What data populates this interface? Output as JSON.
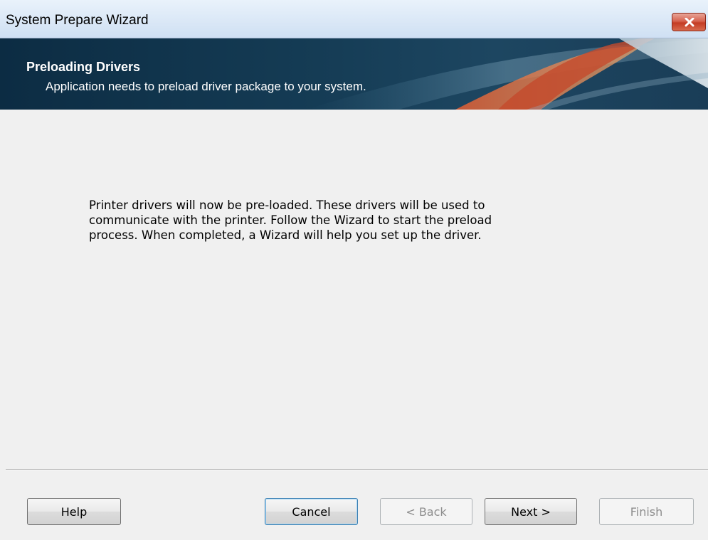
{
  "window": {
    "title": "System Prepare Wizard"
  },
  "header": {
    "title": "Preloading Drivers",
    "subtitle": "Application needs to preload driver package to your system."
  },
  "body": {
    "lines": [
      "Printer drivers will now be pre-loaded. These drivers will be used to",
      "communicate with the printer. Follow the Wizard to start the preload",
      "process. When completed, a Wizard will help you set up the driver."
    ]
  },
  "buttons": {
    "help": "Help",
    "cancel": "Cancel",
    "back": "< Back",
    "next": "Next >",
    "finish": "Finish"
  },
  "icons": {
    "close": "close-icon"
  },
  "colors": {
    "banner": "#153c55",
    "close_button": "#c43c24",
    "default_button_border": "#3c7fb1"
  }
}
